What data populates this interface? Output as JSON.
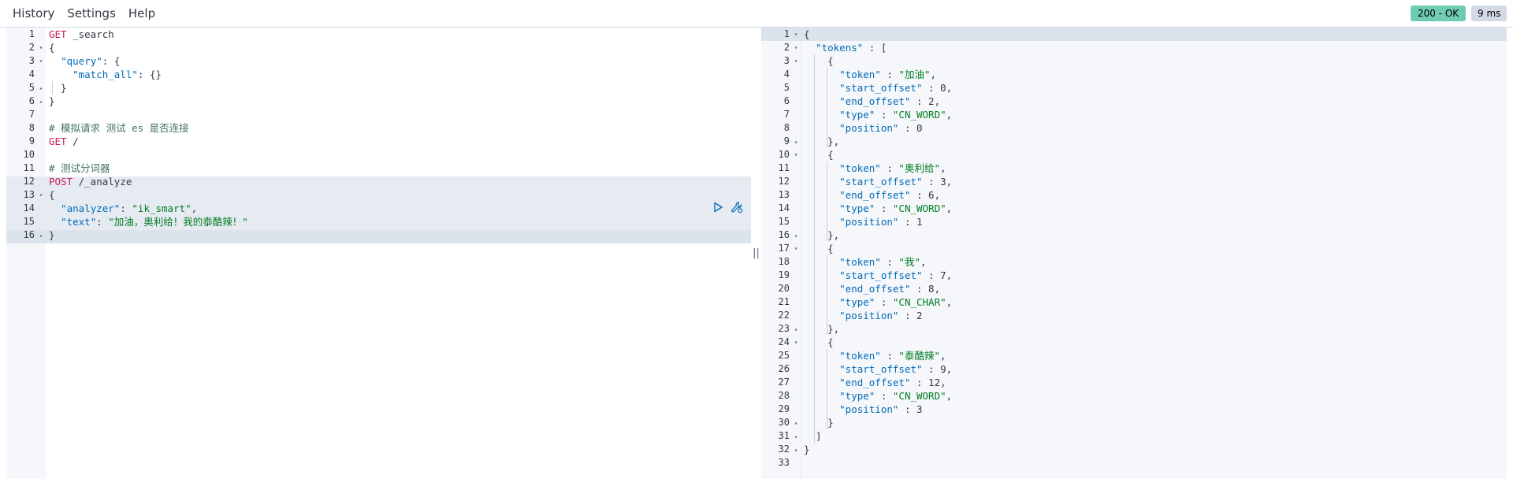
{
  "menu": {
    "items": [
      "History",
      "Settings",
      "Help"
    ]
  },
  "status": {
    "code_text": "200 - OK",
    "time_text": "9 ms"
  },
  "divider": {
    "glyph": "||"
  },
  "request_editor": {
    "lines": [
      {
        "n": "1",
        "fold": "",
        "tokens": [
          [
            "tk-method",
            "GET"
          ],
          [
            "tk-path",
            " _search"
          ]
        ]
      },
      {
        "n": "2",
        "fold": "▾",
        "tokens": [
          [
            "tk-punc",
            "{"
          ]
        ]
      },
      {
        "n": "3",
        "fold": "▾",
        "tokens": [
          [
            "tk-punc",
            "  "
          ],
          [
            "tk-key",
            "\"query\""
          ],
          [
            "tk-punc",
            ": {"
          ]
        ]
      },
      {
        "n": "4",
        "fold": "",
        "tokens": [
          [
            "tk-punc",
            "    "
          ],
          [
            "tk-key",
            "\"match_all\""
          ],
          [
            "tk-punc",
            ": {}"
          ]
        ]
      },
      {
        "n": "5",
        "fold": "▴",
        "tokens": [
          [
            "tk-punc",
            "  }"
          ]
        ]
      },
      {
        "n": "6",
        "fold": "▴",
        "tokens": [
          [
            "tk-punc",
            "}"
          ]
        ]
      },
      {
        "n": "7",
        "fold": "",
        "tokens": []
      },
      {
        "n": "8",
        "fold": "",
        "tokens": [
          [
            "tk-comment",
            "# 模拟请求 测试 es 是否连接"
          ]
        ]
      },
      {
        "n": "9",
        "fold": "",
        "tokens": [
          [
            "tk-method",
            "GET"
          ],
          [
            "tk-path",
            " /"
          ]
        ]
      },
      {
        "n": "10",
        "fold": "",
        "tokens": []
      },
      {
        "n": "11",
        "fold": "",
        "tokens": [
          [
            "tk-comment",
            "# 测试分词器"
          ]
        ]
      },
      {
        "n": "12",
        "fold": "",
        "tokens": [
          [
            "tk-method",
            "POST"
          ],
          [
            "tk-path",
            " /_analyze"
          ]
        ]
      },
      {
        "n": "13",
        "fold": "▾",
        "tokens": [
          [
            "tk-punc",
            "{"
          ]
        ]
      },
      {
        "n": "14",
        "fold": "",
        "tokens": [
          [
            "tk-punc",
            "  "
          ],
          [
            "tk-key",
            "\"analyzer\""
          ],
          [
            "tk-punc",
            ": "
          ],
          [
            "tk-str",
            "\"ik_smart\""
          ],
          [
            "tk-punc",
            ","
          ]
        ]
      },
      {
        "n": "15",
        "fold": "",
        "tokens": [
          [
            "tk-punc",
            "  "
          ],
          [
            "tk-key",
            "\"text\""
          ],
          [
            "tk-punc",
            ": "
          ],
          [
            "tk-str",
            "\"加油，奥利给！我的泰酷辣！\""
          ]
        ]
      },
      {
        "n": "16",
        "fold": "▴",
        "tokens": [
          [
            "tk-punc",
            "}"
          ]
        ]
      }
    ]
  },
  "response_viewer": {
    "lines": [
      {
        "n": "1",
        "fold": "▾",
        "tokens": [
          [
            "tk-punc",
            "{"
          ]
        ]
      },
      {
        "n": "2",
        "fold": "▾",
        "tokens": [
          [
            "tk-punc",
            "  "
          ],
          [
            "tk-key",
            "\"tokens\""
          ],
          [
            "tk-punc",
            " : ["
          ]
        ]
      },
      {
        "n": "3",
        "fold": "▾",
        "tokens": [
          [
            "tk-punc",
            "    {"
          ]
        ]
      },
      {
        "n": "4",
        "fold": "",
        "tokens": [
          [
            "tk-punc",
            "      "
          ],
          [
            "tk-key",
            "\"token\""
          ],
          [
            "tk-punc",
            " : "
          ],
          [
            "tk-str",
            "\"加油\""
          ],
          [
            "tk-punc",
            ","
          ]
        ]
      },
      {
        "n": "5",
        "fold": "",
        "tokens": [
          [
            "tk-punc",
            "      "
          ],
          [
            "tk-key",
            "\"start_offset\""
          ],
          [
            "tk-punc",
            " : "
          ],
          [
            "tk-num",
            "0"
          ],
          [
            "tk-punc",
            ","
          ]
        ]
      },
      {
        "n": "6",
        "fold": "",
        "tokens": [
          [
            "tk-punc",
            "      "
          ],
          [
            "tk-key",
            "\"end_offset\""
          ],
          [
            "tk-punc",
            " : "
          ],
          [
            "tk-num",
            "2"
          ],
          [
            "tk-punc",
            ","
          ]
        ]
      },
      {
        "n": "7",
        "fold": "",
        "tokens": [
          [
            "tk-punc",
            "      "
          ],
          [
            "tk-key",
            "\"type\""
          ],
          [
            "tk-punc",
            " : "
          ],
          [
            "tk-str",
            "\"CN_WORD\""
          ],
          [
            "tk-punc",
            ","
          ]
        ]
      },
      {
        "n": "8",
        "fold": "",
        "tokens": [
          [
            "tk-punc",
            "      "
          ],
          [
            "tk-key",
            "\"position\""
          ],
          [
            "tk-punc",
            " : "
          ],
          [
            "tk-num",
            "0"
          ]
        ]
      },
      {
        "n": "9",
        "fold": "▴",
        "tokens": [
          [
            "tk-punc",
            "    },"
          ]
        ]
      },
      {
        "n": "10",
        "fold": "▾",
        "tokens": [
          [
            "tk-punc",
            "    {"
          ]
        ]
      },
      {
        "n": "11",
        "fold": "",
        "tokens": [
          [
            "tk-punc",
            "      "
          ],
          [
            "tk-key",
            "\"token\""
          ],
          [
            "tk-punc",
            " : "
          ],
          [
            "tk-str",
            "\"奥利给\""
          ],
          [
            "tk-punc",
            ","
          ]
        ]
      },
      {
        "n": "12",
        "fold": "",
        "tokens": [
          [
            "tk-punc",
            "      "
          ],
          [
            "tk-key",
            "\"start_offset\""
          ],
          [
            "tk-punc",
            " : "
          ],
          [
            "tk-num",
            "3"
          ],
          [
            "tk-punc",
            ","
          ]
        ]
      },
      {
        "n": "13",
        "fold": "",
        "tokens": [
          [
            "tk-punc",
            "      "
          ],
          [
            "tk-key",
            "\"end_offset\""
          ],
          [
            "tk-punc",
            " : "
          ],
          [
            "tk-num",
            "6"
          ],
          [
            "tk-punc",
            ","
          ]
        ]
      },
      {
        "n": "14",
        "fold": "",
        "tokens": [
          [
            "tk-punc",
            "      "
          ],
          [
            "tk-key",
            "\"type\""
          ],
          [
            "tk-punc",
            " : "
          ],
          [
            "tk-str",
            "\"CN_WORD\""
          ],
          [
            "tk-punc",
            ","
          ]
        ]
      },
      {
        "n": "15",
        "fold": "",
        "tokens": [
          [
            "tk-punc",
            "      "
          ],
          [
            "tk-key",
            "\"position\""
          ],
          [
            "tk-punc",
            " : "
          ],
          [
            "tk-num",
            "1"
          ]
        ]
      },
      {
        "n": "16",
        "fold": "▴",
        "tokens": [
          [
            "tk-punc",
            "    },"
          ]
        ]
      },
      {
        "n": "17",
        "fold": "▾",
        "tokens": [
          [
            "tk-punc",
            "    {"
          ]
        ]
      },
      {
        "n": "18",
        "fold": "",
        "tokens": [
          [
            "tk-punc",
            "      "
          ],
          [
            "tk-key",
            "\"token\""
          ],
          [
            "tk-punc",
            " : "
          ],
          [
            "tk-str",
            "\"我\""
          ],
          [
            "tk-punc",
            ","
          ]
        ]
      },
      {
        "n": "19",
        "fold": "",
        "tokens": [
          [
            "tk-punc",
            "      "
          ],
          [
            "tk-key",
            "\"start_offset\""
          ],
          [
            "tk-punc",
            " : "
          ],
          [
            "tk-num",
            "7"
          ],
          [
            "tk-punc",
            ","
          ]
        ]
      },
      {
        "n": "20",
        "fold": "",
        "tokens": [
          [
            "tk-punc",
            "      "
          ],
          [
            "tk-key",
            "\"end_offset\""
          ],
          [
            "tk-punc",
            " : "
          ],
          [
            "tk-num",
            "8"
          ],
          [
            "tk-punc",
            ","
          ]
        ]
      },
      {
        "n": "21",
        "fold": "",
        "tokens": [
          [
            "tk-punc",
            "      "
          ],
          [
            "tk-key",
            "\"type\""
          ],
          [
            "tk-punc",
            " : "
          ],
          [
            "tk-str",
            "\"CN_CHAR\""
          ],
          [
            "tk-punc",
            ","
          ]
        ]
      },
      {
        "n": "22",
        "fold": "",
        "tokens": [
          [
            "tk-punc",
            "      "
          ],
          [
            "tk-key",
            "\"position\""
          ],
          [
            "tk-punc",
            " : "
          ],
          [
            "tk-num",
            "2"
          ]
        ]
      },
      {
        "n": "23",
        "fold": "▴",
        "tokens": [
          [
            "tk-punc",
            "    },"
          ]
        ]
      },
      {
        "n": "24",
        "fold": "▾",
        "tokens": [
          [
            "tk-punc",
            "    {"
          ]
        ]
      },
      {
        "n": "25",
        "fold": "",
        "tokens": [
          [
            "tk-punc",
            "      "
          ],
          [
            "tk-key",
            "\"token\""
          ],
          [
            "tk-punc",
            " : "
          ],
          [
            "tk-str",
            "\"泰酷辣\""
          ],
          [
            "tk-punc",
            ","
          ]
        ]
      },
      {
        "n": "26",
        "fold": "",
        "tokens": [
          [
            "tk-punc",
            "      "
          ],
          [
            "tk-key",
            "\"start_offset\""
          ],
          [
            "tk-punc",
            " : "
          ],
          [
            "tk-num",
            "9"
          ],
          [
            "tk-punc",
            ","
          ]
        ]
      },
      {
        "n": "27",
        "fold": "",
        "tokens": [
          [
            "tk-punc",
            "      "
          ],
          [
            "tk-key",
            "\"end_offset\""
          ],
          [
            "tk-punc",
            " : "
          ],
          [
            "tk-num",
            "12"
          ],
          [
            "tk-punc",
            ","
          ]
        ]
      },
      {
        "n": "28",
        "fold": "",
        "tokens": [
          [
            "tk-punc",
            "      "
          ],
          [
            "tk-key",
            "\"type\""
          ],
          [
            "tk-punc",
            " : "
          ],
          [
            "tk-str",
            "\"CN_WORD\""
          ],
          [
            "tk-punc",
            ","
          ]
        ]
      },
      {
        "n": "29",
        "fold": "",
        "tokens": [
          [
            "tk-punc",
            "      "
          ],
          [
            "tk-key",
            "\"position\""
          ],
          [
            "tk-punc",
            " : "
          ],
          [
            "tk-num",
            "3"
          ]
        ]
      },
      {
        "n": "30",
        "fold": "▴",
        "tokens": [
          [
            "tk-punc",
            "    }"
          ]
        ]
      },
      {
        "n": "31",
        "fold": "▴",
        "tokens": [
          [
            "tk-punc",
            "  ]"
          ]
        ]
      },
      {
        "n": "32",
        "fold": "▴",
        "tokens": [
          [
            "tk-punc",
            "}"
          ]
        ]
      },
      {
        "n": "33",
        "fold": "",
        "tokens": []
      }
    ]
  },
  "icons": {
    "run": "play-icon",
    "settings": "wrench-icon"
  },
  "colors": {
    "status_ok": "#6dccb1",
    "time_badge": "#d3dae6",
    "method": "#c41a5a",
    "key": "#006bb8",
    "string": "#017d22",
    "comment": "#41755c"
  }
}
